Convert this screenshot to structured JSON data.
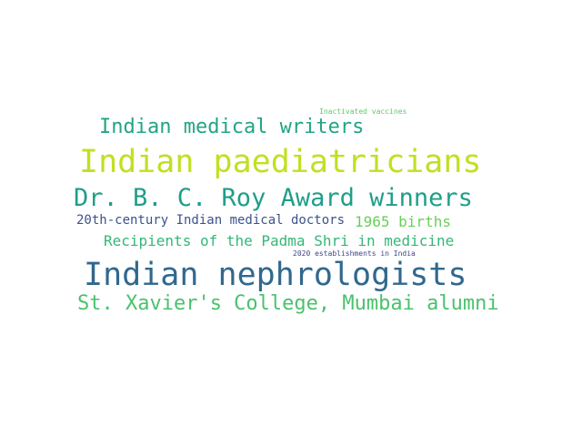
{
  "word_cloud": {
    "words": [
      {
        "text": "Inactivated vaccines",
        "color": "#5ec962"
      },
      {
        "text": "Indian medical writers",
        "color": "#21a585"
      },
      {
        "text": "Indian paediatricians",
        "color": "#c2df23"
      },
      {
        "text": "Dr. B. C. Roy Award winners",
        "color": "#1f9e89"
      },
      {
        "text": "20th-century Indian medical doctors",
        "color": "#3b528b"
      },
      {
        "text": "1965 births",
        "color": "#6ccd5a"
      },
      {
        "text": "Recipients of the Padma Shri in medicine",
        "color": "#35b779"
      },
      {
        "text": "2020 establishments in India",
        "color": "#414487"
      },
      {
        "text": "Indian nephrologists",
        "color": "#31688e"
      },
      {
        "text": "St. Xavier's College, Mumbai alumni",
        "color": "#4ac16d"
      }
    ]
  }
}
